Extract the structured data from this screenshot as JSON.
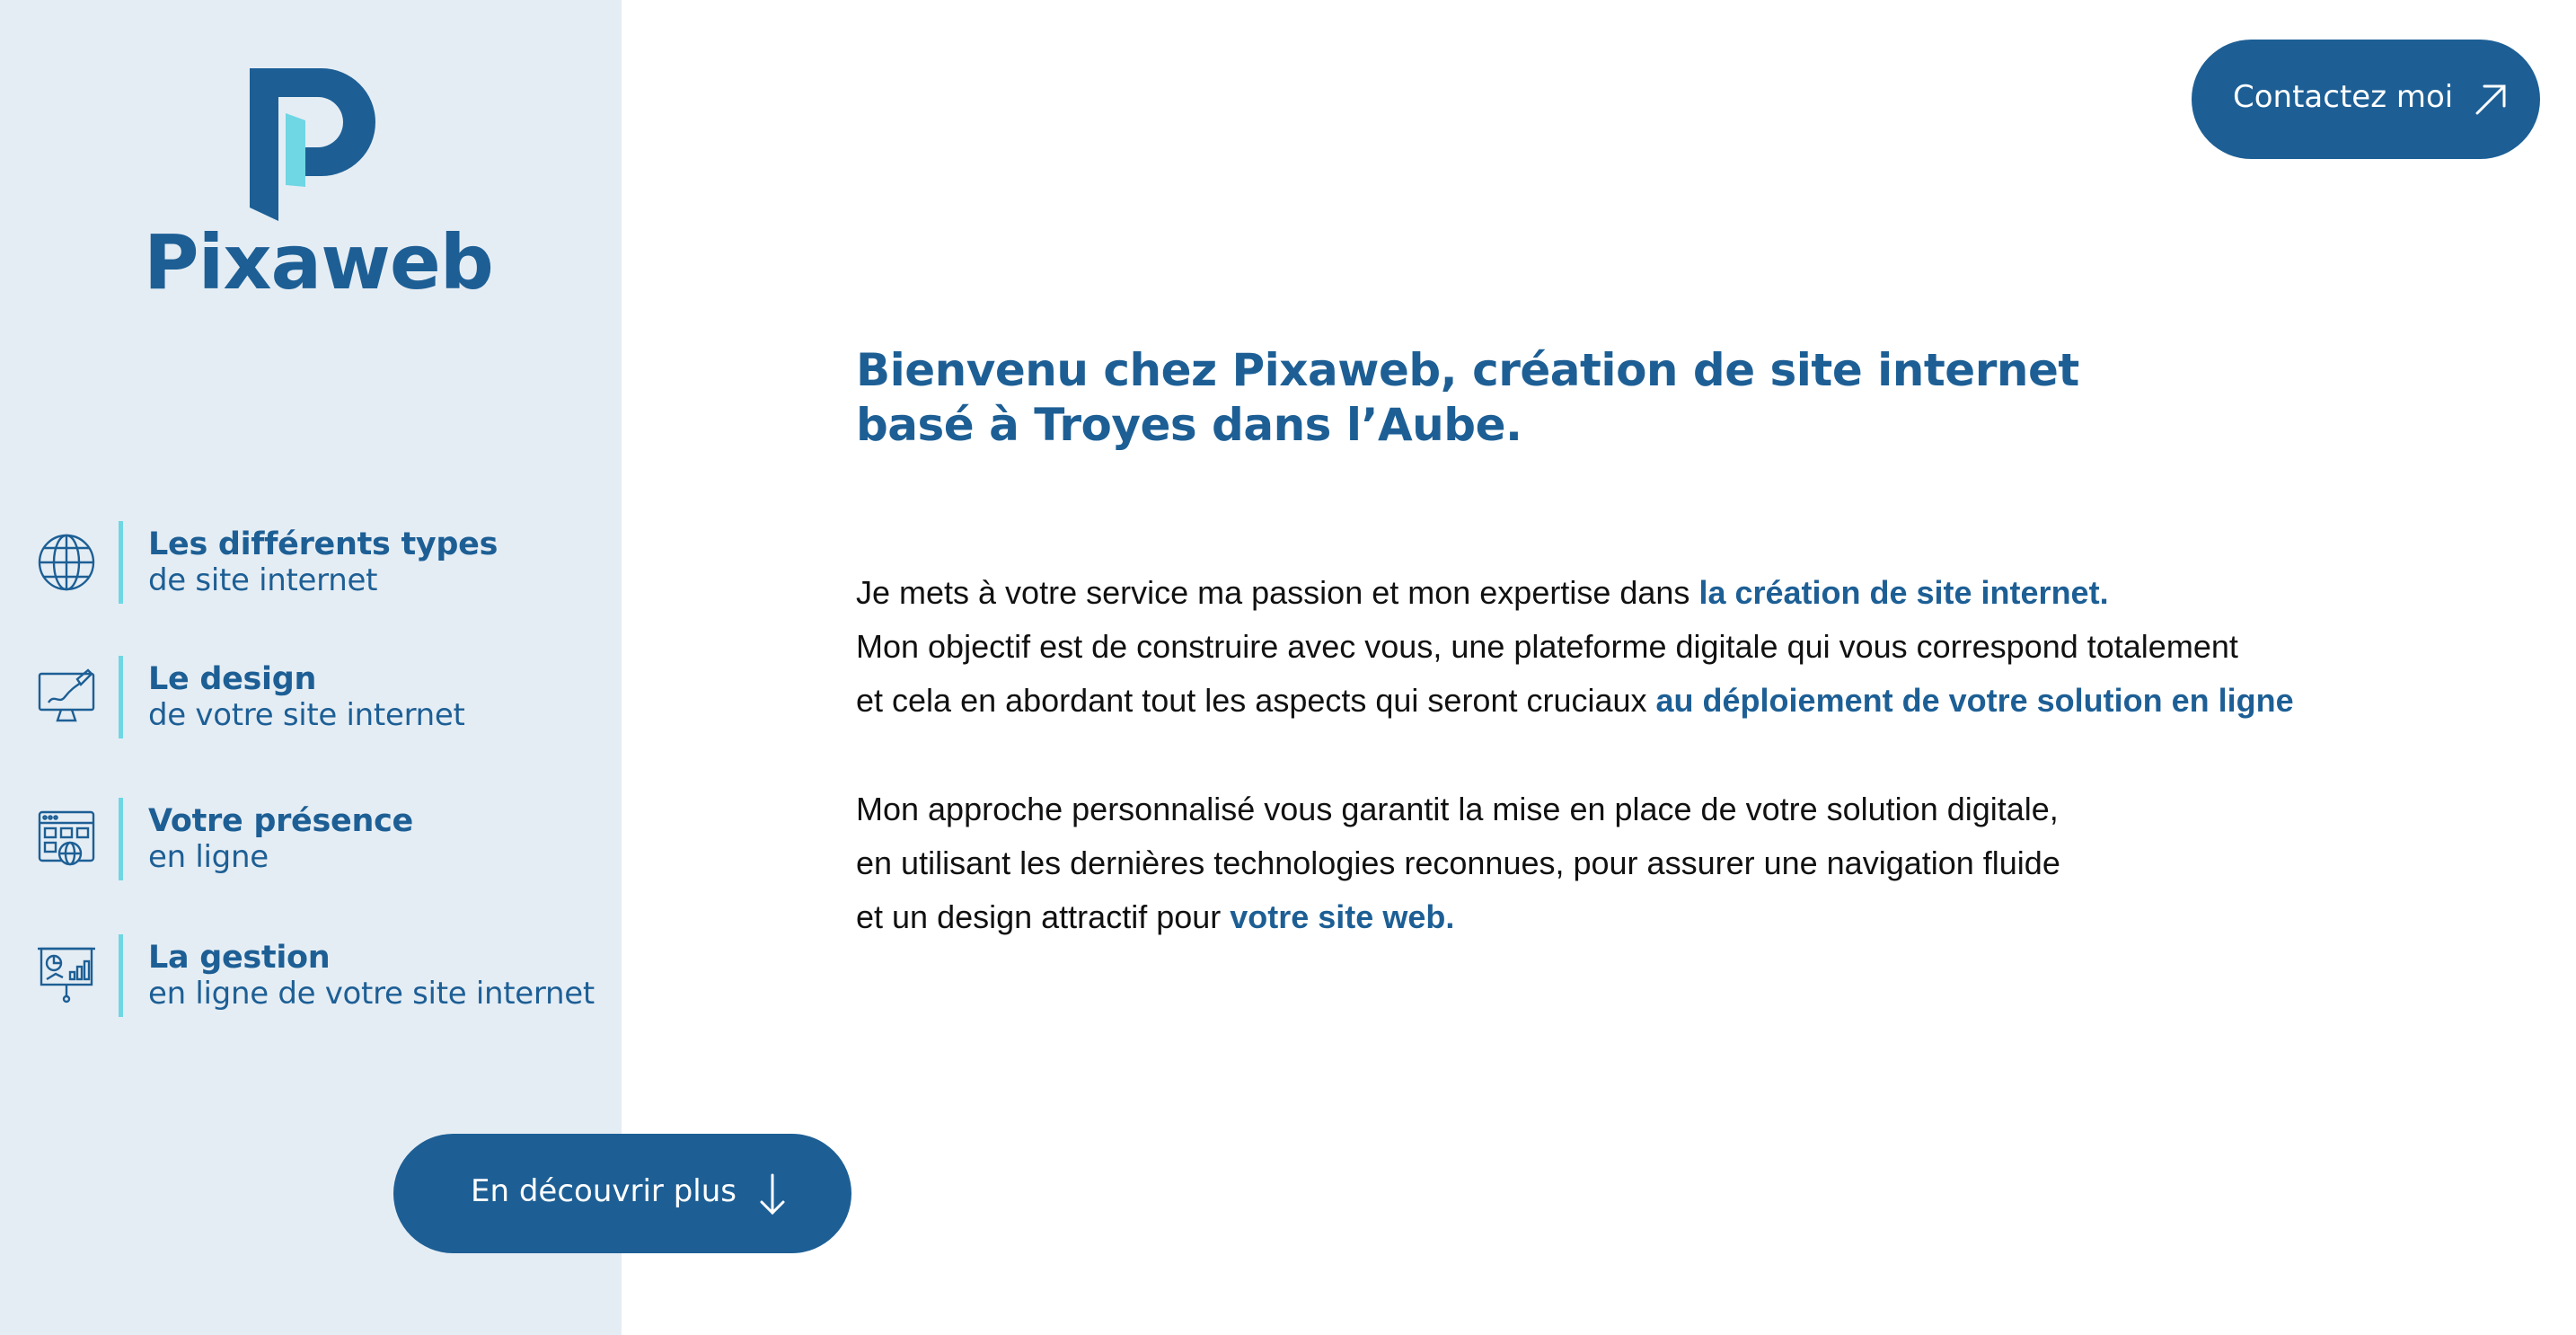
{
  "brand": {
    "name": "Pixaweb",
    "colors": {
      "primary": "#1d5f95",
      "accent": "#6fd6e4",
      "sidebar_bg": "#e5edf4"
    }
  },
  "sidebar": {
    "items": [
      {
        "icon": "globe-icon",
        "title": "Les différents types",
        "subtitle": "de site internet"
      },
      {
        "icon": "design-screen-icon",
        "title": "Le design",
        "subtitle": "de votre site internet"
      },
      {
        "icon": "web-presence-icon",
        "title": "Votre présence",
        "subtitle": "en ligne"
      },
      {
        "icon": "analytics-board-icon",
        "title": "La gestion",
        "subtitle": "en ligne de votre site internet"
      }
    ],
    "discover_button": {
      "label": "En découvrir plus",
      "icon": "arrow-down-icon"
    }
  },
  "header": {
    "contact_button": {
      "label": "Contactez moi",
      "icon": "arrow-up-right-icon"
    }
  },
  "main": {
    "headline": {
      "line1": "Bienvenu chez Pixaweb, création de site internet",
      "line2": "basé à Troyes dans l’Aube."
    },
    "paragraph1": {
      "line1_text": "Je mets à votre service ma passion et mon expertise dans ",
      "line1_highlight": "la création de site internet.",
      "line2_text": "Mon objectif est de construire avec vous, une plateforme digitale qui vous correspond totalement",
      "line3_text": "et cela en abordant tout les aspects qui seront cruciaux ",
      "line3_highlight": "au déploiement de votre solution en ligne"
    },
    "paragraph2": {
      "line1_text": "Mon approche personnalisé vous garantit la mise en place de votre solution digitale,",
      "line2_text": "en utilisant les dernières technologies reconnues, pour assurer une navigation fluide",
      "line3_text": "et un design attractif pour ",
      "line3_highlight": "votre site web."
    }
  }
}
